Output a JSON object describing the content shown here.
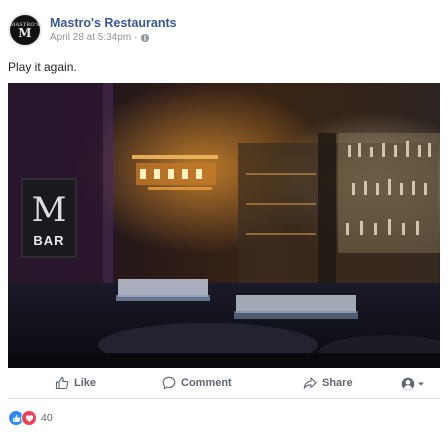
{
  "post": {
    "page_name": "Mastro's Restaurants",
    "timestamp": "April 28 at 5:34pm",
    "separator": "·",
    "avatar_text": "MASTRO'S",
    "avatar_monogram": "M",
    "text": "Play it again."
  },
  "photo": {
    "sign_letter": "M",
    "sign_word": "BAR"
  },
  "actions": {
    "like_label": "Like",
    "comment_label": "Comment",
    "share_label": "Share"
  },
  "reactions": {
    "count": "40",
    "types": [
      "like-icon",
      "love-icon"
    ]
  },
  "colors": {
    "link": "#385898",
    "meta": "#90949c",
    "action": "#606770",
    "like_reaction": "#2e89ff",
    "love_reaction": "#f33e58"
  }
}
